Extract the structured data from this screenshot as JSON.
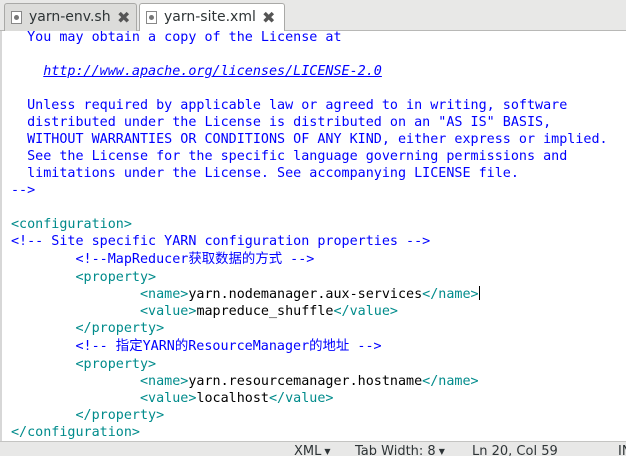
{
  "tabs": [
    {
      "label": "yarn-env.sh",
      "close": "✖"
    },
    {
      "label": "yarn-site.xml",
      "close": "✖"
    }
  ],
  "editor": {
    "l1": "  You may obtain a copy of the License at",
    "l2_pre": "    ",
    "l2_link": "http://www.apache.org/licenses/LICENSE-2.0",
    "l3": "  Unless required by applicable law or agreed to in writing, software",
    "l4": "  distributed under the License is distributed on an \"AS IS\" BASIS,",
    "l5": "  WITHOUT WARRANTIES OR CONDITIONS OF ANY KIND, either express or implied.",
    "l6": "  See the License for the specific language governing permissions and",
    "l7": "  limitations under the License. See accompanying LICENSE file.",
    "l8": "-->",
    "l9": "<configuration>",
    "l10": "<!-- Site specific YARN configuration properties -->",
    "l11": "        <!--MapReducer获取数据的方式 -->",
    "l12": "        <property>",
    "l13_pre": "                ",
    "l13_open": "<name>",
    "l13_val": "yarn.nodemanager.aux-services",
    "l13_close": "</name>",
    "l14_pre": "                ",
    "l14_open": "<value>",
    "l14_val": "mapreduce_shuffle",
    "l14_close": "</value>",
    "l15": "        </property>",
    "l16": "        <!-- 指定YARN的ResourceManager的地址 -->",
    "l17": "        <property>",
    "l18_pre": "                ",
    "l18_open": "<name>",
    "l18_val": "yarn.resourcemanager.hostname",
    "l18_close": "</name>",
    "l19_pre": "                ",
    "l19_open": "<value>",
    "l19_val": "localhost",
    "l19_close": "</value>",
    "l20": "        </property>",
    "l21": "</configuration>"
  },
  "status": {
    "language": "XML",
    "tab_width": "Tab Width: 8",
    "position": "Ln 20, Col 59",
    "mode": "INS"
  }
}
